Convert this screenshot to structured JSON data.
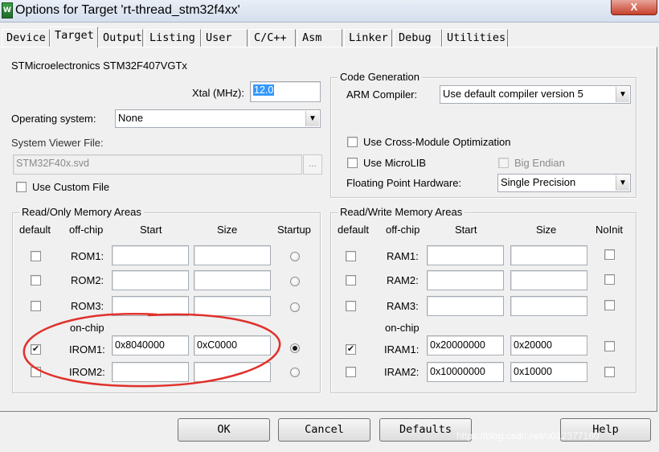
{
  "window": {
    "title": "Options for Target 'rt-thread_stm32f4xx'",
    "icon_text": "W",
    "close_label": "X"
  },
  "tabs": [
    {
      "label": "Device"
    },
    {
      "label": "Target",
      "active": true
    },
    {
      "label": "Output"
    },
    {
      "label": "Listing"
    },
    {
      "label": "User"
    },
    {
      "label": "C/C++"
    },
    {
      "label": "Asm"
    },
    {
      "label": "Linker"
    },
    {
      "label": "Debug"
    },
    {
      "label": "Utilities"
    }
  ],
  "target": {
    "device_name": "STMicroelectronics STM32F407VGTx",
    "xtal_label": "Xtal (MHz):",
    "xtal_value": "12.0",
    "os_label": "Operating system:",
    "os_value": "None",
    "svd_label": "System Viewer File:",
    "svd_value": "STM32F40x.svd",
    "svd_browse": "...",
    "use_custom_file": {
      "label": "Use Custom File",
      "checked": false
    }
  },
  "code_generation": {
    "title": "Code Generation",
    "arm_compiler_label": "ARM Compiler:",
    "arm_compiler_value": "Use default compiler version 5",
    "cross_module": {
      "label": "Use Cross-Module Optimization",
      "checked": false
    },
    "microlib": {
      "label": "Use MicroLIB",
      "checked": false
    },
    "big_endian": {
      "label": "Big Endian",
      "checked": false,
      "enabled": false
    },
    "fpu_label": "Floating Point Hardware:",
    "fpu_value": "Single Precision"
  },
  "ro_memory": {
    "title": "Read/Only Memory Areas",
    "headers": {
      "default": "default",
      "offchip": "off-chip",
      "start": "Start",
      "size": "Size",
      "startup": "Startup"
    },
    "onchip_label": "on-chip",
    "rows": [
      {
        "label": "ROM1:",
        "default": false,
        "start": "",
        "size": "",
        "startup": false
      },
      {
        "label": "ROM2:",
        "default": false,
        "start": "",
        "size": "",
        "startup": false
      },
      {
        "label": "ROM3:",
        "default": false,
        "start": "",
        "size": "",
        "startup": false
      },
      {
        "label": "IROM1:",
        "default": true,
        "start": "0x8040000",
        "size": "0xC0000",
        "startup": true
      },
      {
        "label": "IROM2:",
        "default": false,
        "start": "",
        "size": "",
        "startup": false
      }
    ]
  },
  "rw_memory": {
    "title": "Read/Write Memory Areas",
    "headers": {
      "default": "default",
      "offchip": "off-chip",
      "start": "Start",
      "size": "Size",
      "noinit": "NoInit"
    },
    "onchip_label": "on-chip",
    "rows": [
      {
        "label": "RAM1:",
        "default": false,
        "start": "",
        "size": "",
        "noinit": false
      },
      {
        "label": "RAM2:",
        "default": false,
        "start": "",
        "size": "",
        "noinit": false
      },
      {
        "label": "RAM3:",
        "default": false,
        "start": "",
        "size": "",
        "noinit": false
      },
      {
        "label": "IRAM1:",
        "default": true,
        "start": "0x20000000",
        "size": "0x20000",
        "noinit": false
      },
      {
        "label": "IRAM2:",
        "default": false,
        "start": "0x10000000",
        "size": "0x10000",
        "noinit": false
      }
    ]
  },
  "buttons": {
    "ok": "OK",
    "cancel": "Cancel",
    "defaults": "Defaults",
    "help": "Help"
  },
  "annotation_color": "#e0312b",
  "watermark": "https://blog.csdn.net/u012377160"
}
